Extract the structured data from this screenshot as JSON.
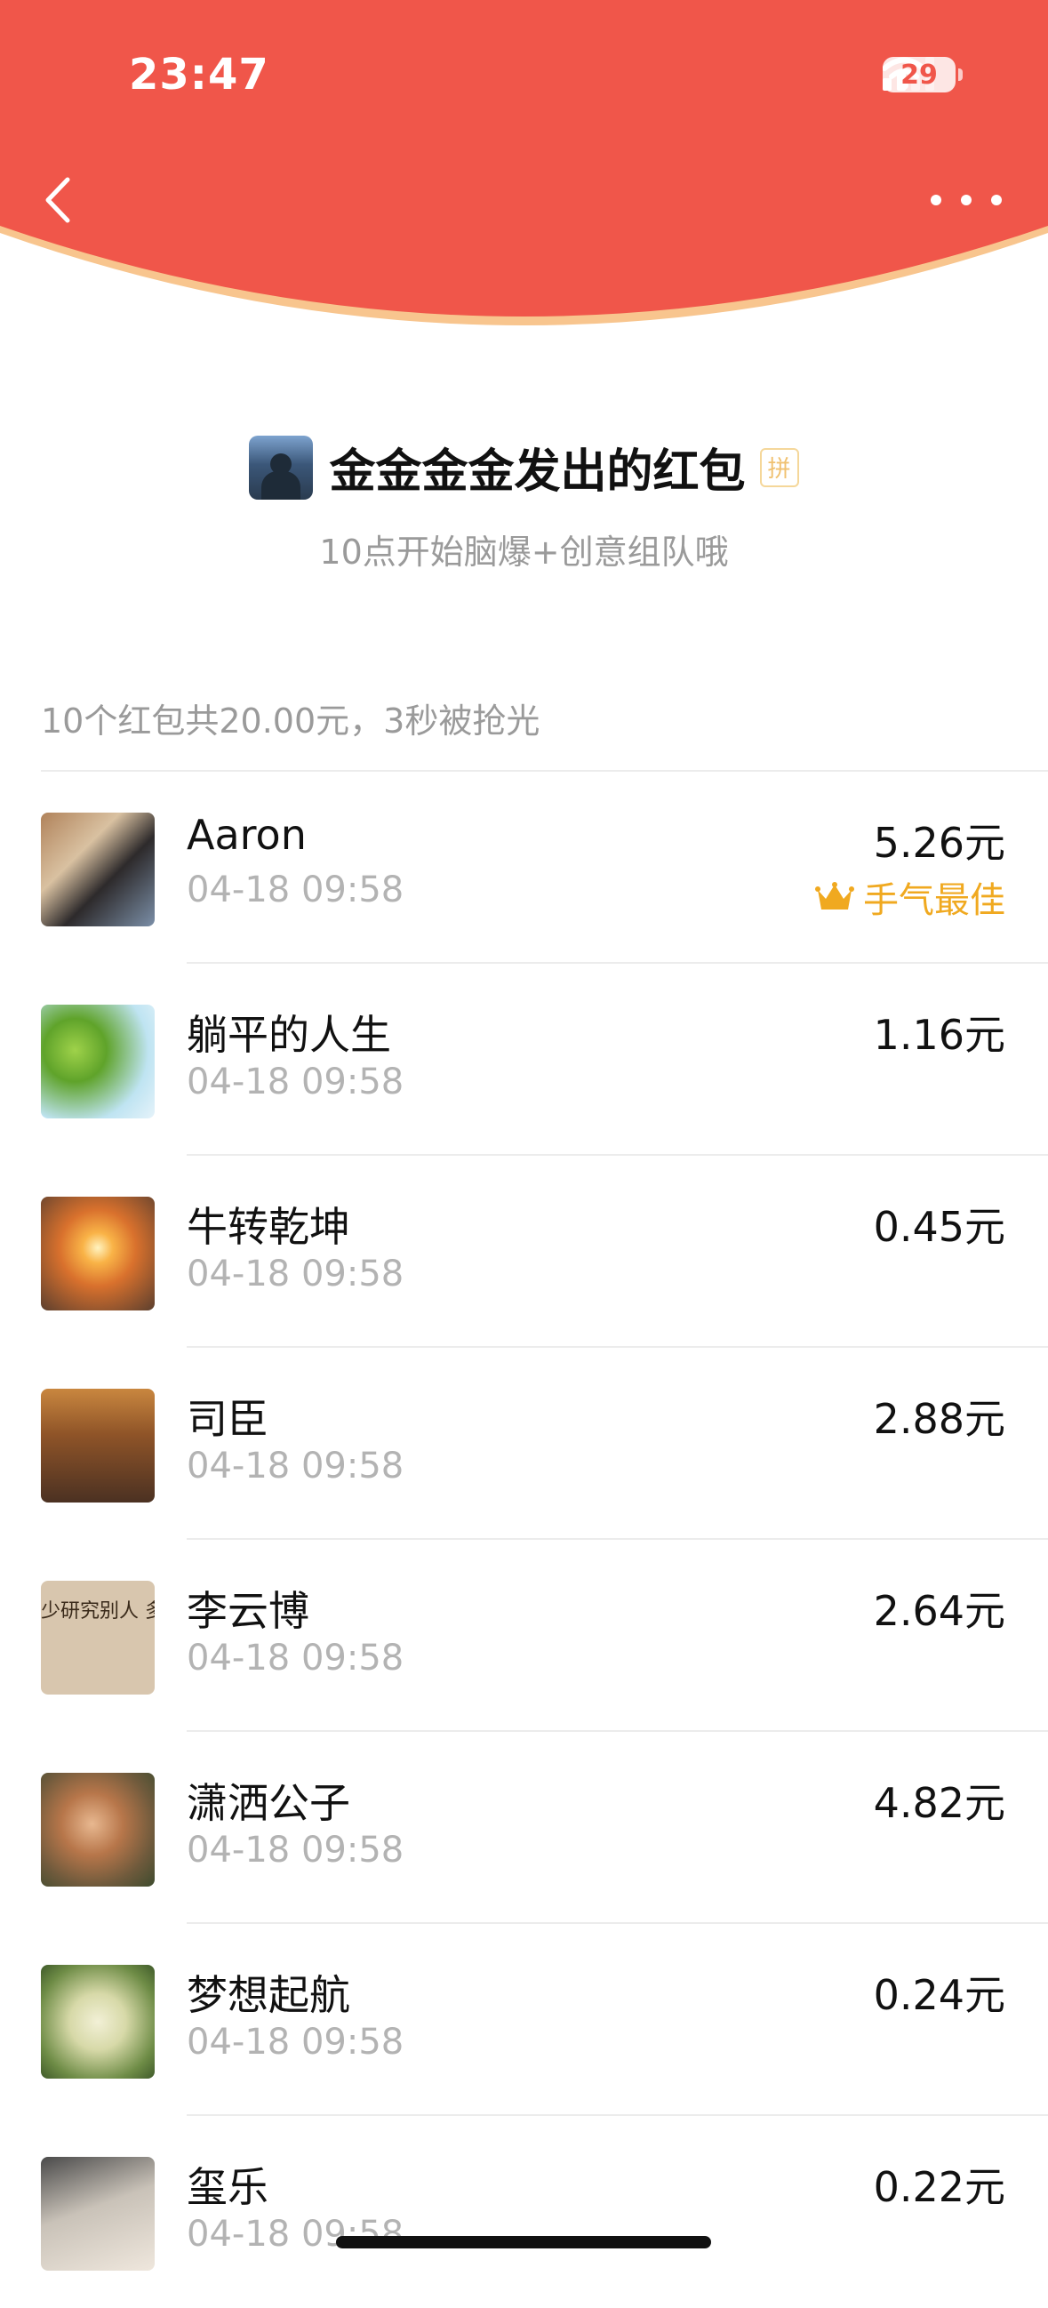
{
  "status_bar": {
    "time": "23:47",
    "battery": "29"
  },
  "header": {
    "color": "#F0564A",
    "rim_color": "#F8C58E"
  },
  "packet": {
    "title": "金金金金发出的红包",
    "pin_badge": "拼",
    "subtitle": "10点开始脑爆+创意组队哦"
  },
  "summary": "10个红包共20.00元，3秒被抢光",
  "records": [
    {
      "name": "Aaron",
      "time": "04-18 09:58",
      "amount": "5.26元",
      "best_label": "手气最佳"
    },
    {
      "name": "躺平的人生",
      "time": "04-18 09:58",
      "amount": "1.16元"
    },
    {
      "name": "牛转乾坤",
      "time": "04-18 09:58",
      "amount": "0.45元"
    },
    {
      "name": "司臣",
      "time": "04-18 09:58",
      "amount": "2.88元"
    },
    {
      "name": "李云博",
      "time": "04-18 09:58",
      "amount": "2.64元",
      "avatar_text": "少研究别人 多塑造自己"
    },
    {
      "name": "潇洒公子",
      "time": "04-18 09:58",
      "amount": "4.82元"
    },
    {
      "name": "梦想起航",
      "time": "04-18 09:58",
      "amount": "0.24元"
    },
    {
      "name": "玺乐",
      "time": "04-18 09:58",
      "amount": "0.22元"
    }
  ]
}
